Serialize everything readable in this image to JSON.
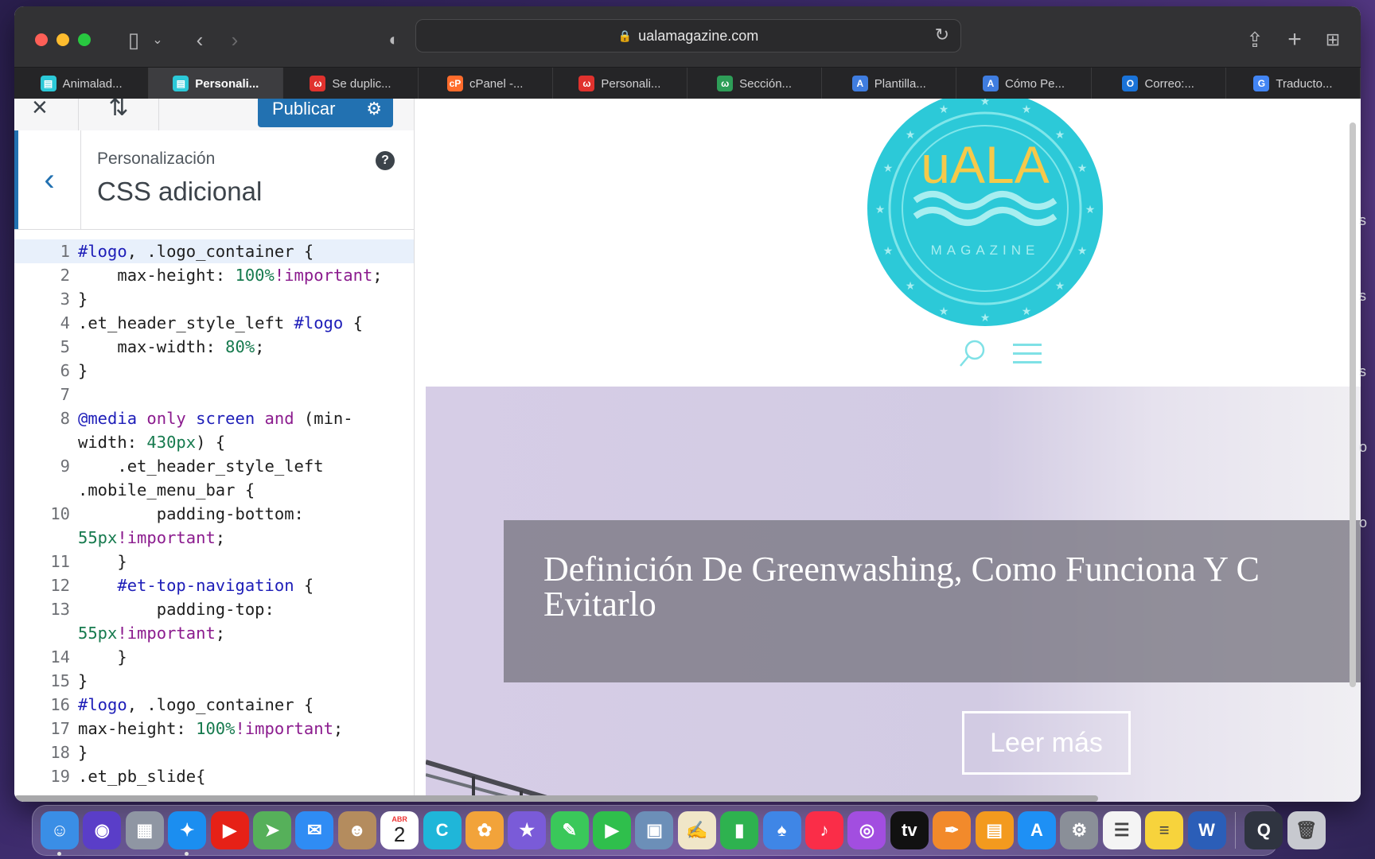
{
  "browser": {
    "url": "ualamagazine.com",
    "tabs": [
      {
        "label": "Animalad...",
        "icon": "customizer-favicon",
        "color": "#2cc9d8"
      },
      {
        "label": "Personali...",
        "icon": "customizer-favicon",
        "color": "#2cc9d8",
        "active": true
      },
      {
        "label": "Se duplic...",
        "icon": "webempresa-favicon",
        "color": "#e0322e"
      },
      {
        "label": "cPanel -...",
        "icon": "cpanel-favicon",
        "color": "#ff6c2c"
      },
      {
        "label": "Personali...",
        "icon": "webempresa-favicon",
        "color": "#e0322e"
      },
      {
        "label": "Sección...",
        "icon": "w-favicon",
        "color": "#2e9e58"
      },
      {
        "label": "Plantilla...",
        "icon": "a-favicon",
        "color": "#3f7de0"
      },
      {
        "label": "Cómo Pe...",
        "icon": "a-favicon",
        "color": "#3f7de0"
      },
      {
        "label": "Correo:...",
        "icon": "outlook-favicon",
        "color": "#1a73d9"
      },
      {
        "label": "Traducto...",
        "icon": "translate-favicon",
        "color": "#4285f4"
      }
    ]
  },
  "customizer": {
    "publish_label": "Publicar",
    "breadcrumb": "Personalización",
    "section_title": "CSS adicional",
    "accent_color": "#2271b1"
  },
  "css_lines": [
    {
      "n": "1",
      "hl": true,
      "parts": [
        [
          "k",
          "#logo"
        ],
        [
          "t",
          ", .logo_container {"
        ]
      ]
    },
    {
      "n": "2",
      "parts": [
        [
          "t",
          "    max-height: "
        ],
        [
          "n",
          "100%"
        ],
        [
          "p",
          "!important"
        ],
        [
          "t",
          ";"
        ]
      ]
    },
    {
      "n": "3",
      "parts": [
        [
          "t",
          "}"
        ]
      ]
    },
    {
      "n": "4",
      "parts": [
        [
          "t",
          ".et_header_style_left "
        ],
        [
          "k",
          "#logo"
        ],
        [
          "t",
          " {"
        ]
      ]
    },
    {
      "n": "5",
      "parts": [
        [
          "t",
          "    max-width: "
        ],
        [
          "n",
          "80%"
        ],
        [
          "t",
          ";"
        ]
      ]
    },
    {
      "n": "6",
      "parts": [
        [
          "t",
          "}"
        ]
      ]
    },
    {
      "n": "7",
      "parts": [
        [
          "t",
          " "
        ]
      ]
    },
    {
      "n": "8",
      "parts": [
        [
          "k",
          "@media"
        ],
        [
          "t",
          " "
        ],
        [
          "p",
          "only"
        ],
        [
          "t",
          " "
        ],
        [
          "k",
          "screen"
        ],
        [
          "t",
          " "
        ],
        [
          "p",
          "and"
        ],
        [
          "t",
          " (min-\nwidth: "
        ],
        [
          "n",
          "430px"
        ],
        [
          "t",
          ") {"
        ]
      ]
    },
    {
      "n": "9",
      "parts": [
        [
          "t",
          "    .et_header_style_left\n.mobile_menu_bar {"
        ]
      ]
    },
    {
      "n": "10",
      "parts": [
        [
          "t",
          "        padding-bottom:\n"
        ],
        [
          "n",
          "55px"
        ],
        [
          "p",
          "!important"
        ],
        [
          "t",
          ";"
        ]
      ]
    },
    {
      "n": "11",
      "parts": [
        [
          "t",
          "    }"
        ]
      ]
    },
    {
      "n": "12",
      "parts": [
        [
          "t",
          "    "
        ],
        [
          "k",
          "#et-top-navigation"
        ],
        [
          "t",
          " {"
        ]
      ]
    },
    {
      "n": "13",
      "parts": [
        [
          "t",
          "        padding-top:\n"
        ],
        [
          "n",
          "55px"
        ],
        [
          "p",
          "!important"
        ],
        [
          "t",
          ";"
        ]
      ]
    },
    {
      "n": "14",
      "parts": [
        [
          "t",
          "    }"
        ]
      ]
    },
    {
      "n": "15",
      "parts": [
        [
          "t",
          "}"
        ]
      ]
    },
    {
      "n": "16",
      "parts": [
        [
          "k",
          "#logo"
        ],
        [
          "t",
          ", .logo_container {"
        ]
      ]
    },
    {
      "n": "17",
      "parts": [
        [
          "t",
          "max-height: "
        ],
        [
          "n",
          "100%"
        ],
        [
          "p",
          "!important"
        ],
        [
          "t",
          ";"
        ]
      ]
    },
    {
      "n": "18",
      "parts": [
        [
          "t",
          "}"
        ]
      ]
    },
    {
      "n": "19",
      "parts": [
        [
          "t",
          ".et_pb_slide{"
        ]
      ]
    }
  ],
  "site": {
    "logo_text": "uALA",
    "logo_sub": "MAGAZINE",
    "logo_color": "#2cc9d8",
    "hero_title_line1": "Definición De Greenwashing, Como Funciona Y C",
    "hero_title_line2": "Evitarlo",
    "hero_button": "Leer más"
  },
  "dock": {
    "calendar_month": "ABR",
    "calendar_day": "2",
    "apps": [
      {
        "name": "finder-icon",
        "color": "#3a8ee6",
        "glyph": "☺",
        "dot": true
      },
      {
        "name": "siri-icon",
        "color": "#5a3ec8",
        "glyph": "◉"
      },
      {
        "name": "launchpad-icon",
        "color": "#8f96a3",
        "glyph": "▦"
      },
      {
        "name": "safari-icon",
        "color": "#1b8ef0",
        "glyph": "✦",
        "dot": true
      },
      {
        "name": "youtube-icon",
        "color": "#e62117",
        "glyph": "▶"
      },
      {
        "name": "maps-icon",
        "color": "#56b05a",
        "glyph": "➤"
      },
      {
        "name": "mail-icon",
        "color": "#2f8cf4",
        "glyph": "✉"
      },
      {
        "name": "contacts-icon",
        "color": "#b48c5e",
        "glyph": "☻"
      },
      {
        "name": "calendar-icon",
        "color": "#ffffff",
        "glyph": ""
      },
      {
        "name": "canva-icon",
        "color": "#1fb6d9",
        "glyph": "C"
      },
      {
        "name": "photos-icon",
        "color": "#f2a33a",
        "glyph": "✿"
      },
      {
        "name": "imovie-icon",
        "color": "#7a5bd8",
        "glyph": "★"
      },
      {
        "name": "messages-icon",
        "color": "#3ac85a",
        "glyph": "✎"
      },
      {
        "name": "facetime-icon",
        "color": "#2fbf4c",
        "glyph": "▶"
      },
      {
        "name": "preview-icon",
        "color": "#6c8fb8",
        "glyph": "▣"
      },
      {
        "name": "textedit-icon",
        "color": "#f0e6c8",
        "glyph": "✍"
      },
      {
        "name": "numbers-icon",
        "color": "#2eb24f",
        "glyph": "▮"
      },
      {
        "name": "keynote-icon",
        "color": "#3f86e6",
        "glyph": "♠"
      },
      {
        "name": "music-icon",
        "color": "#fa2d48",
        "glyph": "♪"
      },
      {
        "name": "podcasts-icon",
        "color": "#a24ee0",
        "glyph": "◎"
      },
      {
        "name": "appletv-icon",
        "color": "#111111",
        "glyph": "tv"
      },
      {
        "name": "pages-icon",
        "color": "#f28a2b",
        "glyph": "✒"
      },
      {
        "name": "books-icon",
        "color": "#f39a1e",
        "glyph": "▤"
      },
      {
        "name": "appstore-icon",
        "color": "#1e90f5",
        "glyph": "A"
      },
      {
        "name": "system-preferences-icon",
        "color": "#8a8f98",
        "glyph": "⚙"
      },
      {
        "name": "reminders-icon",
        "color": "#f4f4f4",
        "glyph": "☰"
      },
      {
        "name": "notes-icon",
        "color": "#f7d33c",
        "glyph": "≡"
      },
      {
        "name": "word-icon",
        "color": "#2b5eb8",
        "glyph": "W"
      }
    ],
    "trailing": [
      {
        "name": "quicktime-icon",
        "color": "#2f3440",
        "glyph": "Q"
      },
      {
        "name": "trash-icon",
        "color": "#c7c9cf",
        "glyph": "🗑"
      }
    ]
  }
}
